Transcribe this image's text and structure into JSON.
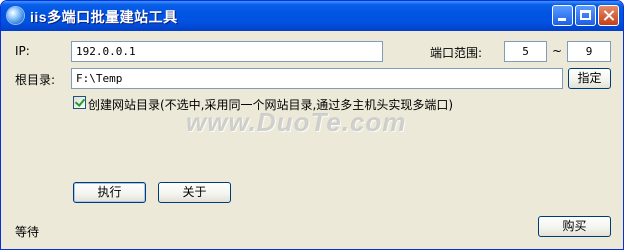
{
  "window": {
    "title": "iis多端口批量建站工具"
  },
  "form": {
    "ip_label": "IP:",
    "ip_value": "192.0.0.1",
    "port_range_label": "端口范围:",
    "port_start": "5",
    "port_separator": "~",
    "port_end": "9",
    "root_dir_label": "根目录:",
    "root_dir_value": "F:\\Temp",
    "browse_button": "指定",
    "create_site_dir_checkbox": {
      "checked": true,
      "label": "创建网站目录(不选中,采用同一个网站目录,通过多主机头实现多端口)"
    }
  },
  "watermark": "www.DuoTe.com",
  "buttons": {
    "execute": "执行",
    "about": "关于",
    "buy": "购买"
  },
  "status": {
    "text": "等待"
  }
}
